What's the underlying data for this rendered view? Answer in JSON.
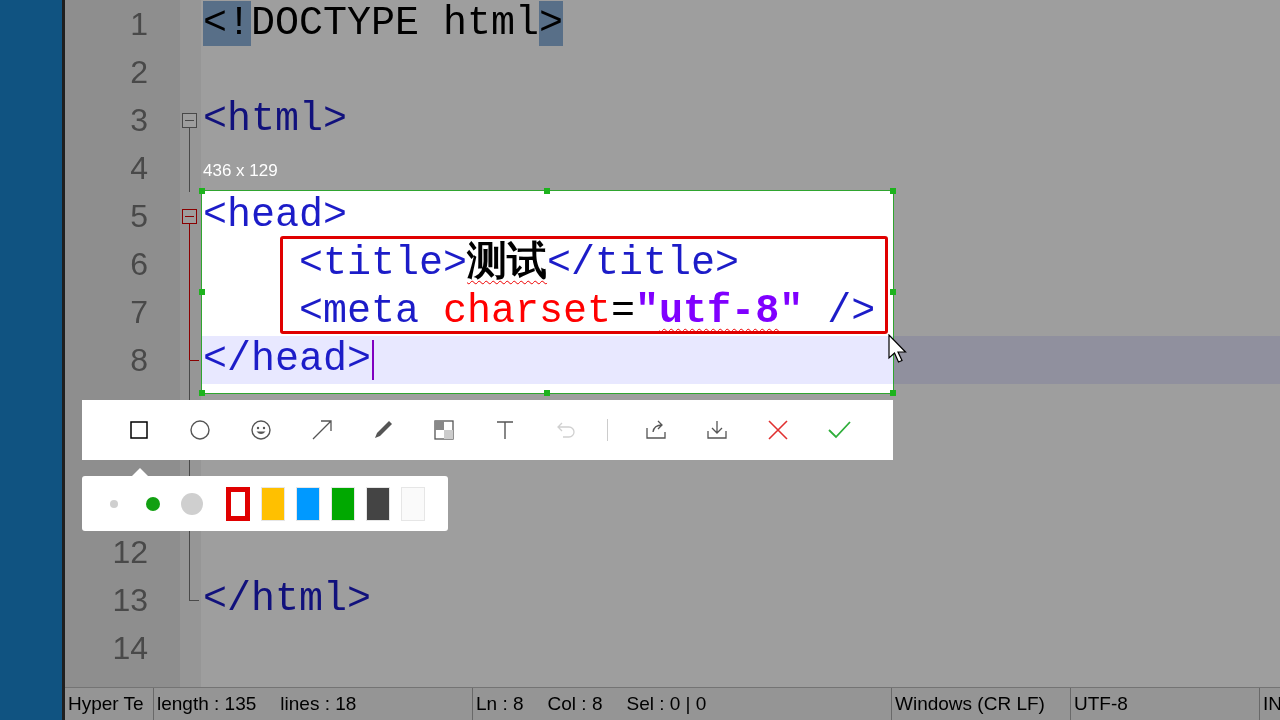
{
  "editor": {
    "lines_top": [
      {
        "number": "1",
        "tokens": [
          {
            "kind": "match",
            "text": "<!"
          },
          {
            "kind": "doctype",
            "text": "DOCTYPE html"
          },
          {
            "kind": "match",
            "text": ">"
          }
        ]
      },
      {
        "number": "2"
      },
      {
        "number": "3",
        "kind": "foldstart",
        "in_current_fold": false,
        "tokens": [
          {
            "kind": "tag",
            "text": "<html>"
          }
        ]
      },
      {
        "number": "4",
        "kind": "foldbody",
        "in_current_fold": false
      },
      {
        "number": "5",
        "kind": "foldstart",
        "in_current_fold": true,
        "tokens": [
          {
            "kind": "tag",
            "text": "<head>"
          }
        ]
      },
      {
        "number": "6",
        "kind": "foldbody",
        "in_current_fold": true,
        "tokens": [
          {
            "kind": "tag",
            "text": "    <title>"
          },
          {
            "kind": "content",
            "text": "测试",
            "misspelled": true
          },
          {
            "kind": "tag",
            "text": "</title>"
          }
        ]
      },
      {
        "number": "7",
        "kind": "foldbody",
        "in_current_fold": true,
        "tokens": [
          {
            "kind": "tag",
            "text": "    <meta "
          },
          {
            "kind": "attr",
            "text": "charset"
          },
          {
            "kind": "op",
            "text": "="
          },
          {
            "kind": "value",
            "text": "\""
          },
          {
            "kind": "value",
            "text": "utf-8",
            "misspelled": true
          },
          {
            "kind": "value",
            "text": "\""
          },
          {
            "kind": "tag",
            "text": " />"
          }
        ]
      },
      {
        "number": "8",
        "kind": "foldend",
        "in_current_fold": true,
        "current": true,
        "caret": true,
        "tokens": [
          {
            "kind": "tag",
            "text": "</head>"
          }
        ]
      }
    ],
    "lines_bottom": [
      {
        "number": "12",
        "kind": "foldbody",
        "in_current_fold": false
      },
      {
        "number": "13",
        "kind": "foldend",
        "in_current_fold": false,
        "tokens": [
          {
            "kind": "tag",
            "text": "</html>"
          }
        ]
      },
      {
        "number": "14"
      }
    ]
  },
  "capture": {
    "size_label": "436 x 129",
    "tools": [
      {
        "kind": "rectangle",
        "selected": true,
        "disabled": false
      },
      {
        "kind": "ellipse",
        "selected": false,
        "disabled": false
      },
      {
        "kind": "smiley",
        "selected": false,
        "disabled": false
      },
      {
        "kind": "arrow",
        "selected": false,
        "disabled": false
      },
      {
        "kind": "pen",
        "selected": false,
        "disabled": false
      },
      {
        "kind": "mosaic",
        "selected": false,
        "disabled": false
      },
      {
        "kind": "text",
        "selected": false,
        "disabled": false
      },
      {
        "kind": "undo",
        "selected": false,
        "disabled": true
      }
    ],
    "actions": [
      {
        "kind": "share"
      },
      {
        "kind": "download"
      },
      {
        "kind": "cancel"
      },
      {
        "kind": "confirm"
      }
    ],
    "sizes": [
      {
        "selected": false
      },
      {
        "selected": true
      },
      {
        "selected": false
      }
    ],
    "colors": [
      {
        "color": "#e00000",
        "selected": true
      },
      {
        "color": "#ffc000",
        "selected": false
      },
      {
        "color": "#0099ff",
        "selected": false
      },
      {
        "color": "#00a800",
        "selected": false
      },
      {
        "color": "#444444",
        "selected": false
      },
      {
        "color": "#fafafa",
        "selected": false
      }
    ]
  },
  "status_bar": {
    "panels": [
      [
        "Hyper Te"
      ],
      [
        "length : 135",
        "lines : 18"
      ],
      [
        "Ln : 8",
        "Col : 8",
        "Sel : 0 | 0"
      ],
      [
        "Windows (CR LF)"
      ],
      [
        "UTF-8"
      ],
      [
        "IN"
      ]
    ]
  }
}
